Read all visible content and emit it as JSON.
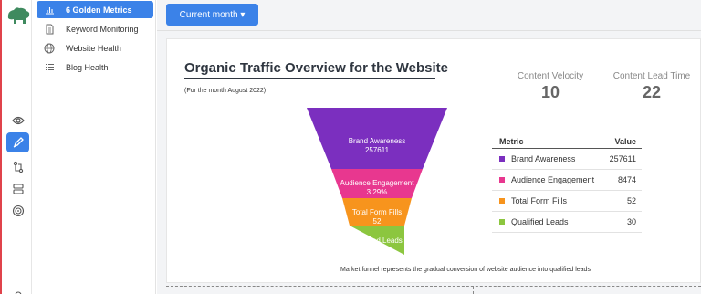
{
  "sidebar": {
    "items": [
      {
        "label": "6 Golden Metrics",
        "icon": "bar-chart-icon"
      },
      {
        "label": "Keyword Monitoring",
        "icon": "document-icon"
      },
      {
        "label": "Website Health",
        "icon": "globe-icon"
      },
      {
        "label": "Blog Health",
        "icon": "list-icon"
      }
    ]
  },
  "toolbar": {
    "month_label": "Current month ▾"
  },
  "overview": {
    "title": "Organic Traffic Overview for the Website",
    "subtitle": "(For the month August 2022)",
    "caption": "Market funnel represents the gradual conversion of website audience into qualified leads"
  },
  "kpis": [
    {
      "label": "Content Velocity",
      "value": "10"
    },
    {
      "label": "Content Lead Time",
      "value": "22"
    }
  ],
  "funnel": [
    {
      "name": "Brand Awareness",
      "value": "257611",
      "color": "#7b2fbf"
    },
    {
      "name": "Audience Engagement",
      "value": "3.29%",
      "color": "#e8378f"
    },
    {
      "name": "Total Form Fills",
      "value": "52",
      "color": "#f7941d"
    },
    {
      "name": "Qualified Leads",
      "value": "30",
      "color": "#8cc63f"
    }
  ],
  "table": {
    "headers": {
      "metric": "Metric",
      "value": "Value"
    },
    "rows": [
      {
        "name": "Brand Awareness",
        "value": "257611",
        "color": "#7b2fbf"
      },
      {
        "name": "Audience Engagement",
        "value": "8474",
        "color": "#e8378f"
      },
      {
        "name": "Total Form Fills",
        "value": "52",
        "color": "#f7941d"
      },
      {
        "name": "Qualified Leads",
        "value": "30",
        "color": "#8cc63f"
      }
    ]
  },
  "colors": {
    "accent": "#3b82e8",
    "rail_border": "#e0434b",
    "title": "#2f3640"
  }
}
